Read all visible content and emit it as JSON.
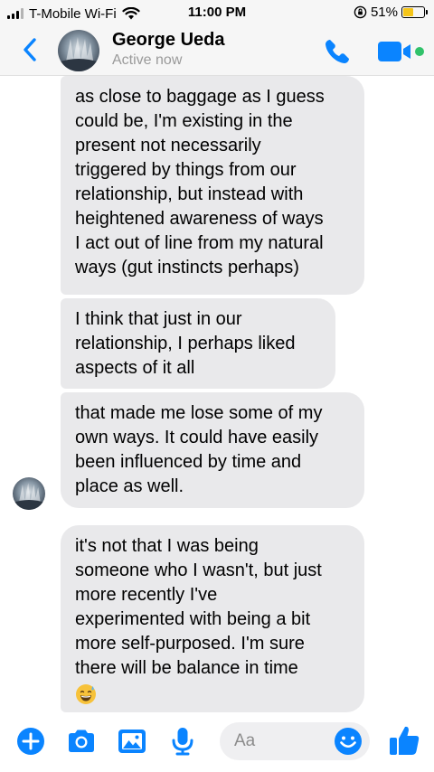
{
  "status_bar": {
    "carrier": "T-Mobile Wi-Fi",
    "time": "11:00 PM",
    "battery": "51%",
    "battery_level": 0.51
  },
  "header": {
    "contact_name": "George Ueda",
    "status": "Active now",
    "accent_color": "#0a84ff",
    "online_color": "#31c26a"
  },
  "messages": [
    {
      "lines": [
        "as close to baggage as I guess",
        "could be, I'm existing in the",
        "present not necessarily",
        "triggered by things from our",
        "relationship, but instead with",
        "heightened awareness of ways",
        "I act out of line from my natural",
        "ways (gut instincts perhaps)"
      ]
    },
    {
      "lines": [
        "I think that just in our",
        "relationship, I perhaps liked",
        "aspects of it all"
      ]
    },
    {
      "lines": [
        "that made me lose some of my",
        "own ways. It could have easily",
        "been influenced by time and",
        "place as well."
      ]
    },
    {
      "lines": [
        "it's not that I was being",
        "someone who I wasn't, but just",
        "more recently I've",
        "experimented with being a bit",
        "more self-purposed. I'm sure",
        "there will be balance in time"
      ],
      "emoji": "grinning-sweat-emoji"
    }
  ],
  "composer": {
    "placeholder": "Aa"
  },
  "icons": {
    "back": "chevron-left-icon",
    "call": "phone-icon",
    "video": "video-camera-icon",
    "add": "plus-icon",
    "camera": "camera-icon",
    "gallery": "photo-icon",
    "mic": "microphone-icon",
    "emoji": "smiley-icon",
    "like": "thumbs-up-icon"
  }
}
